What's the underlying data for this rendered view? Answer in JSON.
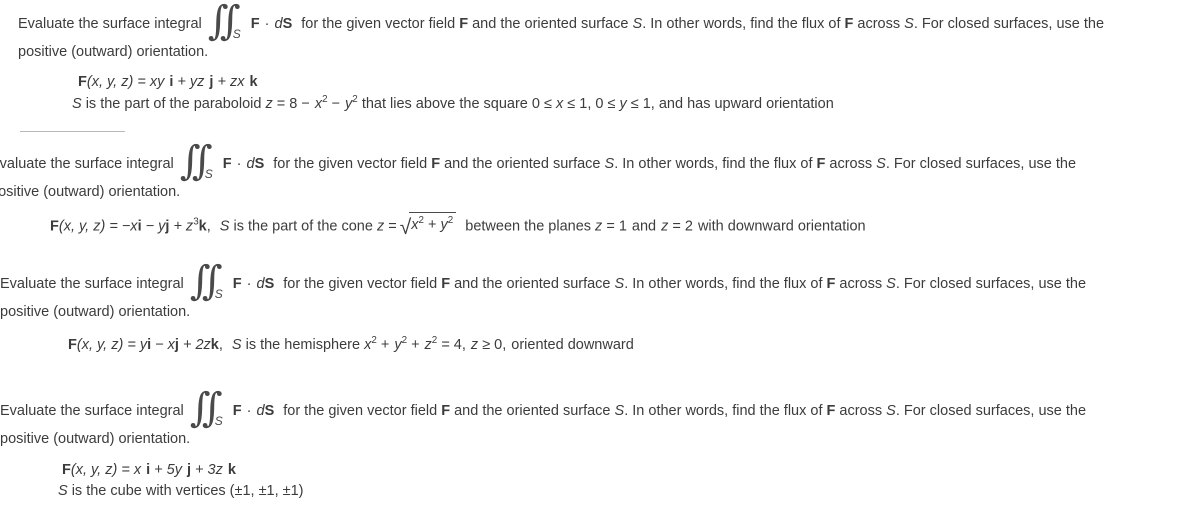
{
  "document": {
    "type": "math-exercise-sheet",
    "background": "#ffffff",
    "text_color": "#3c3c3c",
    "problems": [
      {
        "id": "problem-1",
        "stem_part_1": "Evaluate the surface integral",
        "integral_symbol": "double-integral-over-S",
        "integral_subscript": "S",
        "stem_part_2": "F · dS",
        "stem_part_3": "for the given vector field",
        "stem_part_4": "F",
        "stem_part_5": "and the oriented surface",
        "stem_part_6": "S",
        "stem_part_7": ". In other words, find the flux of",
        "stem_part_8": "F",
        "stem_part_9": "across",
        "stem_part_10": "S",
        "stem_part_11": ". For closed surfaces, use the",
        "stem_line_2": "positive (outward) orientation.",
        "formula_lines": [
          "F(x, y, z) = xy i + yz j + zx k",
          "S is the part of the paraboloid z = 8 − x² − y² that lies above the square 0 ≤ x ≤ 1, 0 ≤ y ≤ 1,  and has upward orientation"
        ]
      },
      {
        "id": "problem-2",
        "stem_part_1": "Evaluate the surface integral",
        "stem_line_2": "positive (outward) orientation.",
        "formula_lines": [
          "F(x, y, z) = −xi − yj + z³k,  S is the part of the cone z = √(x² + y²)  between the planes z = 1  and  z = 2  with downward orientation"
        ]
      },
      {
        "id": "problem-3",
        "stem_part_1": "Evaluate the surface integral",
        "stem_line_2": "positive (outward) orientation.",
        "formula_lines": [
          "F(x, y, z) = yi − xj + 2zk,  S is the hemisphere x² + y² + z² = 4,  z ≥ 0,  oriented downward"
        ]
      },
      {
        "id": "problem-4",
        "stem_part_1": "Evaluate the surface integral",
        "stem_line_2": "positive (outward) orientation.",
        "formula_lines": [
          "F(x, y, z) = x i + 5y j + 3z k",
          "S is the cube with vertices  (±1, ±1, ±1)"
        ]
      }
    ],
    "tokens": {
      "evaluate_stem": "Evaluate the surface integral",
      "dot": "·",
      "dS": "dS",
      "F": "F",
      "S": "S",
      "for_given": "for the given vector field",
      "and_oriented": "and the oriented surface",
      "in_other_words": ". In other words, find the flux of",
      "across": "across",
      "for_closed": ". For closed surfaces, use the",
      "positive_outward": "positive (outward) orientation.",
      "eq": "=",
      "plus": "+",
      "minus": "−",
      "comma": ",",
      "leq": "≤",
      "geq": "≥",
      "pm": "±",
      "radical": "√"
    },
    "p1": {
      "f_lhs": "F",
      "f_args": "(x, y, z)",
      "f_eq": "= xy",
      "i": "i",
      "plus1": "+ yz",
      "j": "j",
      "plus2": "+ zx",
      "k": "k",
      "s_intro": "S",
      "s_text_1": "is the part of the paraboloid",
      "s_z": "z",
      "s_eq8": "= 8 −",
      "s_x": "x",
      "s_sup2a": "2",
      "s_minus": "−",
      "s_y": "y",
      "s_sup2b": "2",
      "s_text_2": "that lies above the square 0 ≤",
      "s_x2": "x",
      "s_text_3": "≤ 1, 0 ≤",
      "s_y2": "y",
      "s_text_4": "≤ 1,  and has upward orientation"
    },
    "p2": {
      "f_lhs": "F",
      "f_args": "(x, y, z)",
      "f_eq": "= −x",
      "i": "i",
      "m1": "− y",
      "j": "j",
      "p1": "+ z",
      "sup3": "3",
      "k": "k",
      "comma": ",",
      "s_intro": "S",
      "s_text_1": "is the part of the cone",
      "s_z": "z",
      "s_eq": "=",
      "rad_x": "x",
      "rad_sup1": "2",
      "rad_plus": "+",
      "rad_y": "y",
      "rad_sup2": "2",
      "s_text_2": "between the planes",
      "s_z1": "z",
      "s_eq1": "= 1",
      "s_and": "and",
      "s_z2": "z",
      "s_eq2": "= 2",
      "s_text_3": "with downward orientation"
    },
    "p3": {
      "f_lhs": "F",
      "f_args": "(x, y, z)",
      "f_eq": "= y",
      "i": "i",
      "m1": "− x",
      "j": "j",
      "p1": "+ 2z",
      "k": "k",
      "comma": ",",
      "s_intro": "S",
      "s_text_1": "is the hemisphere",
      "s_x": "x",
      "sup2a": "2",
      "s_plus1": "+",
      "s_y": "y",
      "sup2b": "2",
      "s_plus2": "+",
      "s_z": "z",
      "sup2c": "2",
      "s_eq4": "= 4,",
      "s_z2": "z",
      "s_geq": "≥ 0,",
      "s_text_2": "oriented downward"
    },
    "p4": {
      "f_lhs": "F",
      "f_args": "(x, y, z)",
      "f_eq": "= x",
      "i": "i",
      "p1": "+ 5y",
      "j": "j",
      "p2": "+ 3z",
      "k": "k",
      "s_intro": "S",
      "s_text_1": "is the cube with vertices  (±1, ±1, ±1)"
    },
    "divider": {
      "present": true,
      "color": "#b9b9b9"
    }
  }
}
